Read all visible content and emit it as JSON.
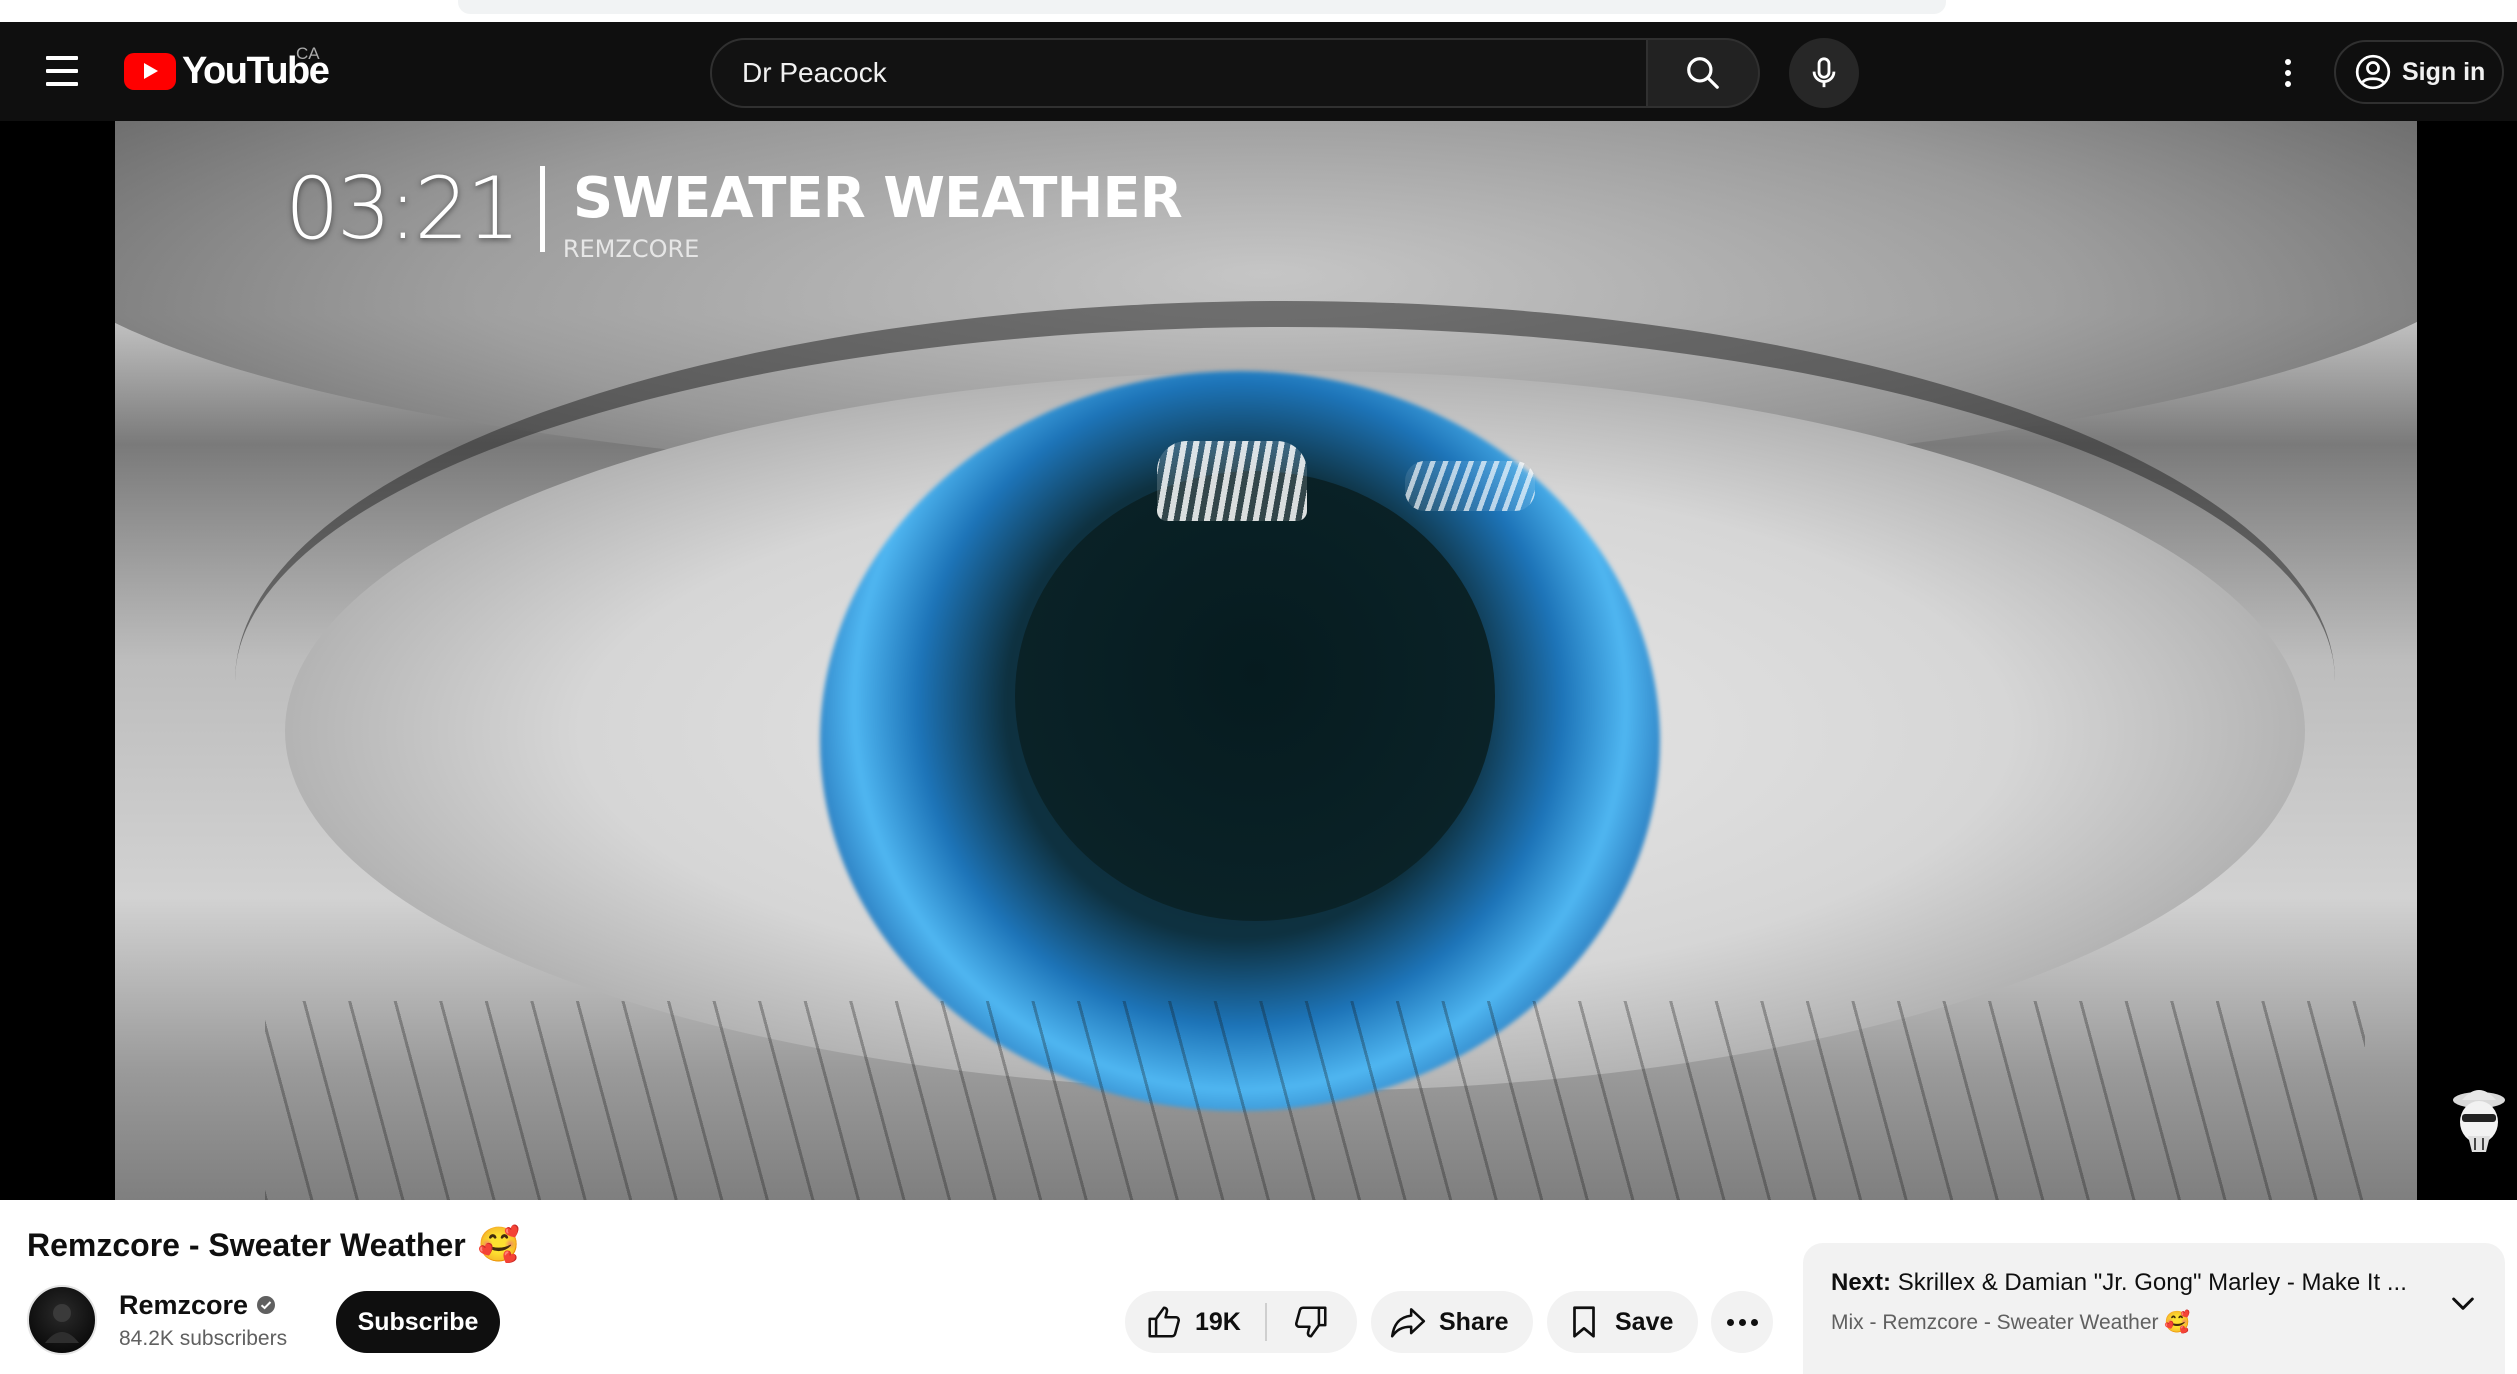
{
  "header": {
    "logo_text": "YouTube",
    "country_code": "CA",
    "search_value": "Dr Peacock",
    "sign_in_label": "Sign in"
  },
  "video_overlay": {
    "time_text": "03:21",
    "song_title": "SWEATER WEATHER",
    "artist": "REMZCORE"
  },
  "video": {
    "title": "Remzcore - Sweater Weather",
    "title_emoji": "🥰"
  },
  "owner": {
    "channel_name": "Remzcore",
    "subscribers": "84.2K subscribers",
    "subscribe_label": "Subscribe"
  },
  "actions": {
    "like_count": "19K",
    "share_label": "Share",
    "save_label": "Save"
  },
  "up_next": {
    "next_prefix": "Next:",
    "next_title": "Skrillex & Damian \"Jr. Gong\" Marley - Make It ...",
    "mix_subtitle": "Mix - Remzcore - Sweater Weather",
    "mix_emoji": "🥰"
  },
  "colors": {
    "masthead_bg": "#0f0f0f",
    "brand_red": "#ff0000",
    "iris_blue": "#4fb6f1",
    "pill_bg": "#f2f2f2"
  },
  "icons": [
    "menu-icon",
    "youtube-logo-icon",
    "search-icon",
    "microphone-icon",
    "more-vert-icon",
    "account-circle-icon",
    "verified-badge-icon",
    "thumb-up-icon",
    "thumb-down-icon",
    "share-icon",
    "bookmark-icon",
    "more-horiz-icon",
    "chevron-down-icon",
    "channel-watermark-icon"
  ]
}
